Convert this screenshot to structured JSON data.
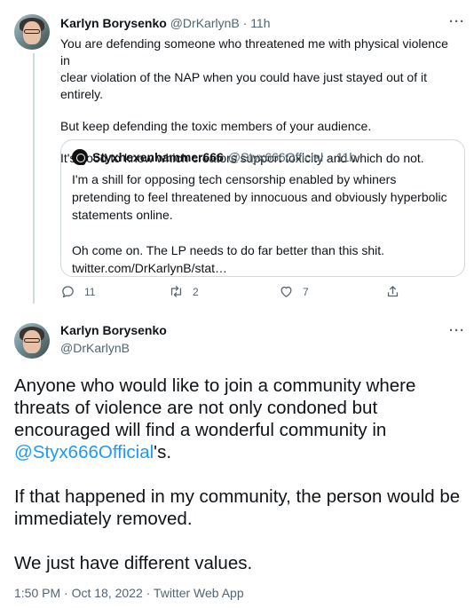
{
  "tweet1": {
    "author_name": "Karlyn Borysenko",
    "author_handle": "@DrKarlynB",
    "separator": "·",
    "time": "11h",
    "more_label": "···",
    "paragraphs": [
      "You are defending someone who threatened me with physical violence in\nclear violation of the NAP when you could have just stayed out of it entirely.",
      "But keep defending the toxic members of your audience.",
      "It's good to know which creators support toxicity and which do not."
    ],
    "quote": {
      "author_name": "Styxhexenhammer666",
      "author_handle": "@Styx666Official",
      "separator": "·",
      "time": "11h",
      "paragraphs": [
        "I'm a shill for opposing tech censorship enabled by whiners pretending to feel threatened by innocuous and obviously hyperbolic statements online.",
        "Oh come on. The LP needs to do far better than this shit.\ntwitter.com/DrKarlynB/stat…"
      ]
    },
    "actions": {
      "replies": "11",
      "retweets": "2",
      "likes": "7"
    }
  },
  "tweet2": {
    "author_name": "Karlyn Borysenko",
    "author_handle": "@DrKarlynB",
    "more_label": "···",
    "para1_text": "Anyone who would like to join a community where threats of violence are not only condoned but encouraged will find a wonderful community in ",
    "para1_mention": "@Styx666Official",
    "para1_suffix": "'s.",
    "para2": "If that happened in my community, the person would be immediately removed.",
    "para3": "We just have different values.",
    "timestamp": "1:50 PM · Oct 18, 2022 · Twitter Web App"
  },
  "colors": {
    "text": "#0f1419",
    "secondary": "#536471",
    "link": "#1d9bf0",
    "border": "#cfd9de"
  }
}
